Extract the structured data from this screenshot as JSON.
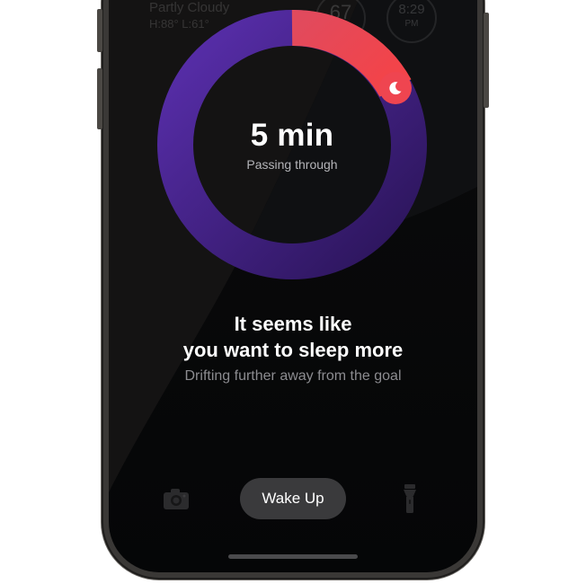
{
  "lockscreen": {
    "weather_condition": "Partly Cloudy",
    "weather_range": "H:88° L:61°",
    "temperature": "67",
    "clock_time": "8:29",
    "clock_period": "PM"
  },
  "sleep_ring": {
    "duration": "5 min",
    "caption": "Passing through",
    "knob_icon": "moon-icon",
    "gradient_colors": [
      "#5a2fae",
      "#2d1660",
      "#f0484f"
    ]
  },
  "message": {
    "headline_line1": "It seems like",
    "headline_line2": "you want to sleep more",
    "subline": "Drifting further away from the goal"
  },
  "controls": {
    "wake_label": "Wake Up",
    "left_icon": "camera-icon",
    "right_icon": "flashlight-icon"
  }
}
